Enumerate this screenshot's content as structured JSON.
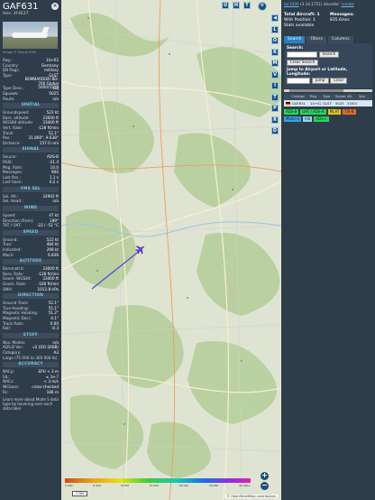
{
  "left": {
    "callsign": "GAF631",
    "hex": "Hex:  3F4E27",
    "photo_credit": "Image © Marcel Kritt",
    "info": [
      {
        "k": "Reg.:",
        "v": "14+02",
        "link": true
      },
      {
        "k": "Country:",
        "v": "Germany"
      },
      {
        "k": "DB flags:",
        "v": "military"
      },
      {
        "k": "Type:",
        "v": "GLST"
      },
      {
        "k": "",
        "v": "BOMBARDIER BD-700 Global 5000/5500",
        "tall": true
      },
      {
        "k": "Type Desc.:",
        "v": "L2J"
      },
      {
        "k": "Squawk:",
        "v": "5025"
      },
      {
        "k": "Route:",
        "v": "n/a"
      }
    ],
    "sections": [
      {
        "title": "SPATIAL",
        "rows": [
          {
            "k": "Groundspeed:",
            "v": "522 kt"
          },
          {
            "k": "Baro. altitude:",
            "v": "33000 ft"
          },
          {
            "k": "WGS84 altitude:",
            "v": "33400 ft"
          },
          {
            "k": "Vert. Rate:",
            "v": "-128 ft/min"
          },
          {
            "k": "Track:",
            "v": "52.1°"
          },
          {
            "k": "Pos.:",
            "v": "31.860°, 9.638°"
          },
          {
            "k": "Distance:",
            "v": "157.0 nmi"
          }
        ]
      },
      {
        "title": "SIGNAL",
        "rows": [
          {
            "k": "Source:",
            "v": "ADS-B"
          },
          {
            "k": "RSSI:",
            "v": "-21.4"
          },
          {
            "k": "Msg. Rate:",
            "v": "10.0"
          },
          {
            "k": "Messages:",
            "v": "900"
          },
          {
            "k": "Last Pos.:",
            "v": "1.1 s"
          },
          {
            "k": "Last Seen:",
            "v": "0.2 s"
          }
        ]
      },
      {
        "title": "FMS SEL",
        "rows": [
          {
            "k": "Sel. Alt.:",
            "v": "32992 ft"
          },
          {
            "k": "Sel. Head.:",
            "v": "n/a"
          }
        ]
      },
      {
        "title": "WIND",
        "rows": [
          {
            "k": "Speed:",
            "v": "47 kt"
          },
          {
            "k": "Direction (from):",
            "v": "189°"
          },
          {
            "k": "TAT / OAT:",
            "v": "-22 / -52 °C"
          }
        ]
      },
      {
        "title": "SPEED",
        "rows": [
          {
            "k": "Ground:",
            "v": "522 kt"
          },
          {
            "k": "True:",
            "v": "484 kt"
          },
          {
            "k": "Indicated:",
            "v": "298 kt"
          },
          {
            "k": "Mach:",
            "v": "0.836"
          }
        ]
      },
      {
        "title": "ALTITUDE",
        "rows": [
          {
            "k": "Barometric:",
            "v": "33000 ft"
          },
          {
            "k": "Baro. Rate:",
            "v": "-128 ft/min"
          },
          {
            "k": "Geom. WGS84:",
            "v": "33400 ft"
          },
          {
            "k": "Geom. Rate:",
            "v": "-160 ft/min"
          },
          {
            "k": "QNH:",
            "v": "1012.8 hPa"
          }
        ]
      },
      {
        "title": "DIRECTION",
        "rows": [
          {
            "k": "Ground Track:",
            "v": "52.1°"
          },
          {
            "k": "True Heading:",
            "v": "55.1°"
          },
          {
            "k": "Magnetic Heading:",
            "v": "51.2°"
          },
          {
            "k": "Magnetic Decl.:",
            "v": "4.1°"
          },
          {
            "k": "Track Rate:",
            "v": "0.00"
          },
          {
            "k": "Roll:",
            "v": "-0.3"
          }
        ]
      },
      {
        "title": "STUFF",
        "rows": [
          {
            "k": "Nav. Modes:",
            "v": "n/a"
          },
          {
            "k": "ADS-B Ver.:",
            "v": "v2 (DO-260B)"
          },
          {
            "k": "Category:",
            "v": "A3"
          },
          {
            "k": "Large (75 000 to 300 000 lb)",
            "v": ""
          }
        ]
      },
      {
        "title": "ACCURACY",
        "rows": [
          {
            "k": "NACp:",
            "v": "EPU < 3 m"
          },
          {
            "k": "SIL:",
            "v": "≤ 1e-7"
          },
          {
            "k": "NACv:",
            "v": "< 3 m/s"
          },
          {
            "k": "NICbaro:",
            "v": "cross-checked"
          },
          {
            "k": "Rc:",
            "v": "186 m"
          }
        ]
      }
    ],
    "learn_more": "Learn more about Mode S data type by hovering over each data label"
  },
  "map": {
    "right_buttons": [
      "◀",
      "L",
      "O",
      "K",
      "M",
      "V",
      "I",
      "T",
      "P",
      "R",
      "D"
    ],
    "top_buttons": [
      "U",
      "H",
      "T"
    ],
    "scale": "2 NM",
    "attribution": "© OpenStreetMap contributors",
    "alt_ticks": [
      "4 000",
      "6 000",
      "8 000",
      "10 000",
      "20 000",
      "30 000",
      "40 000+"
    ],
    "zoom_in": "+",
    "zoom_out": "−",
    "aircraft_color": "#7a3df0",
    "trail_color": "#5a3fe0",
    "aircraft_track_deg": 52.1
  },
  "right": {
    "version_prefix": "tar1090 (3.14.1751) decoder: ",
    "version_link": "tar1090",
    "decoder_link": "readsb",
    "total_aircraft": "Total Aircraft: 1",
    "with_position": "With Position: 1",
    "stats_available": "Stats available",
    "messages_label": "Messages:",
    "messages_value": "835.6/sec",
    "tabs": [
      "Search",
      "Filters",
      "Columns"
    ],
    "search_label": "Search:",
    "search_button": "Search",
    "clear_search": "Clear Search",
    "jump_label": "Jump to Airport or Latitude, Longitude:",
    "jump_button": "Jump",
    "clear_button": "Clear",
    "columns": [
      "",
      "Callsign",
      "Reg.",
      "Type",
      "Squawk",
      "Alt.",
      "Spd"
    ],
    "rows": [
      [
        "",
        "GAF631",
        "14+02",
        "GLST",
        "5025",
        "33000",
        ""
      ]
    ],
    "badges": [
      {
        "label": "ADS-B",
        "color": "#2bd45c"
      },
      {
        "label": "UAT / ADS-R",
        "color": "#2bd45c"
      },
      {
        "label": "MLAT",
        "color": "#e6c12a"
      },
      {
        "label": "TIS-B",
        "color": "#e66a2a"
      },
      {
        "label": "Mode-S",
        "color": "#3aa0e0"
      },
      {
        "label": "AIS",
        "color": "#9ad5ee"
      },
      {
        "label": "ADS-C",
        "color": "#2bd45c"
      }
    ]
  }
}
